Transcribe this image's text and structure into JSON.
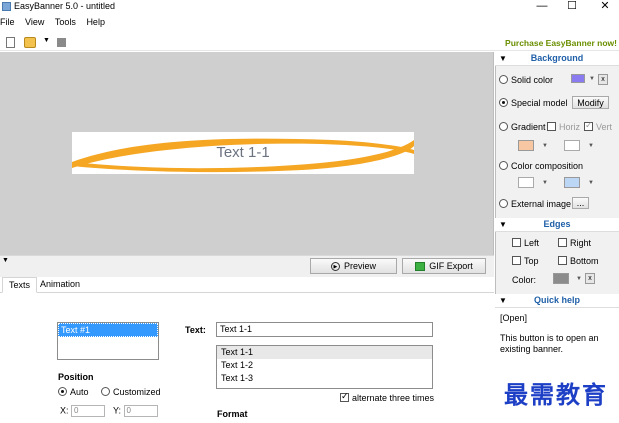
{
  "window": {
    "title": "EasyBanner 5.0 - untitled",
    "min_glyph": "—",
    "max_glyph": "☐",
    "close_glyph": "✕"
  },
  "menu": [
    "File",
    "View",
    "Tools",
    "Help"
  ],
  "toolbar": {
    "purchase_label": "Purchase EasyBanner now!"
  },
  "banner": {
    "text": "Text 1-1",
    "accent_color": "#f5a623"
  },
  "buttons": {
    "preview": "Preview",
    "gif_export": "GIF Export"
  },
  "tabs": [
    "Texts",
    "Animation"
  ],
  "texts_panel": {
    "list_items": [
      "Text #1"
    ],
    "position_label": "Position",
    "radio_auto": "Auto",
    "radio_customized": "Customized",
    "x_label": "X:",
    "x_value": "0",
    "y_label": "Y:",
    "y_value": "0",
    "text_label": "Text:",
    "text_value": "Text 1-1",
    "lines": [
      "Text 1-1",
      "Text 1-2",
      "Text 1-3"
    ],
    "alternate_label": "alternate three times",
    "format_label": "Format"
  },
  "background": {
    "title": "Background",
    "solid_color": "Solid color",
    "special_model": "Special model",
    "modify": "Modify",
    "gradient": "Gradient",
    "horiz": "Horiz",
    "vert": "Vert",
    "color_composition": "Color composition",
    "external_image": "External image",
    "browse": "...",
    "solid_swatch": "#8a7cf0",
    "gradient_swatch": "#f7c6a3",
    "comp_swatch": "#bcd7f5"
  },
  "edges": {
    "title": "Edges",
    "left": "Left",
    "right": "Right",
    "top": "Top",
    "bottom": "Bottom",
    "color_label": "Color:",
    "x": "x",
    "swatch": "#8c8c8c"
  },
  "quick_help": {
    "title": "Quick help",
    "tag": "[Open]",
    "body": "This button is to open an existing banner."
  },
  "watermark": "最需教育"
}
